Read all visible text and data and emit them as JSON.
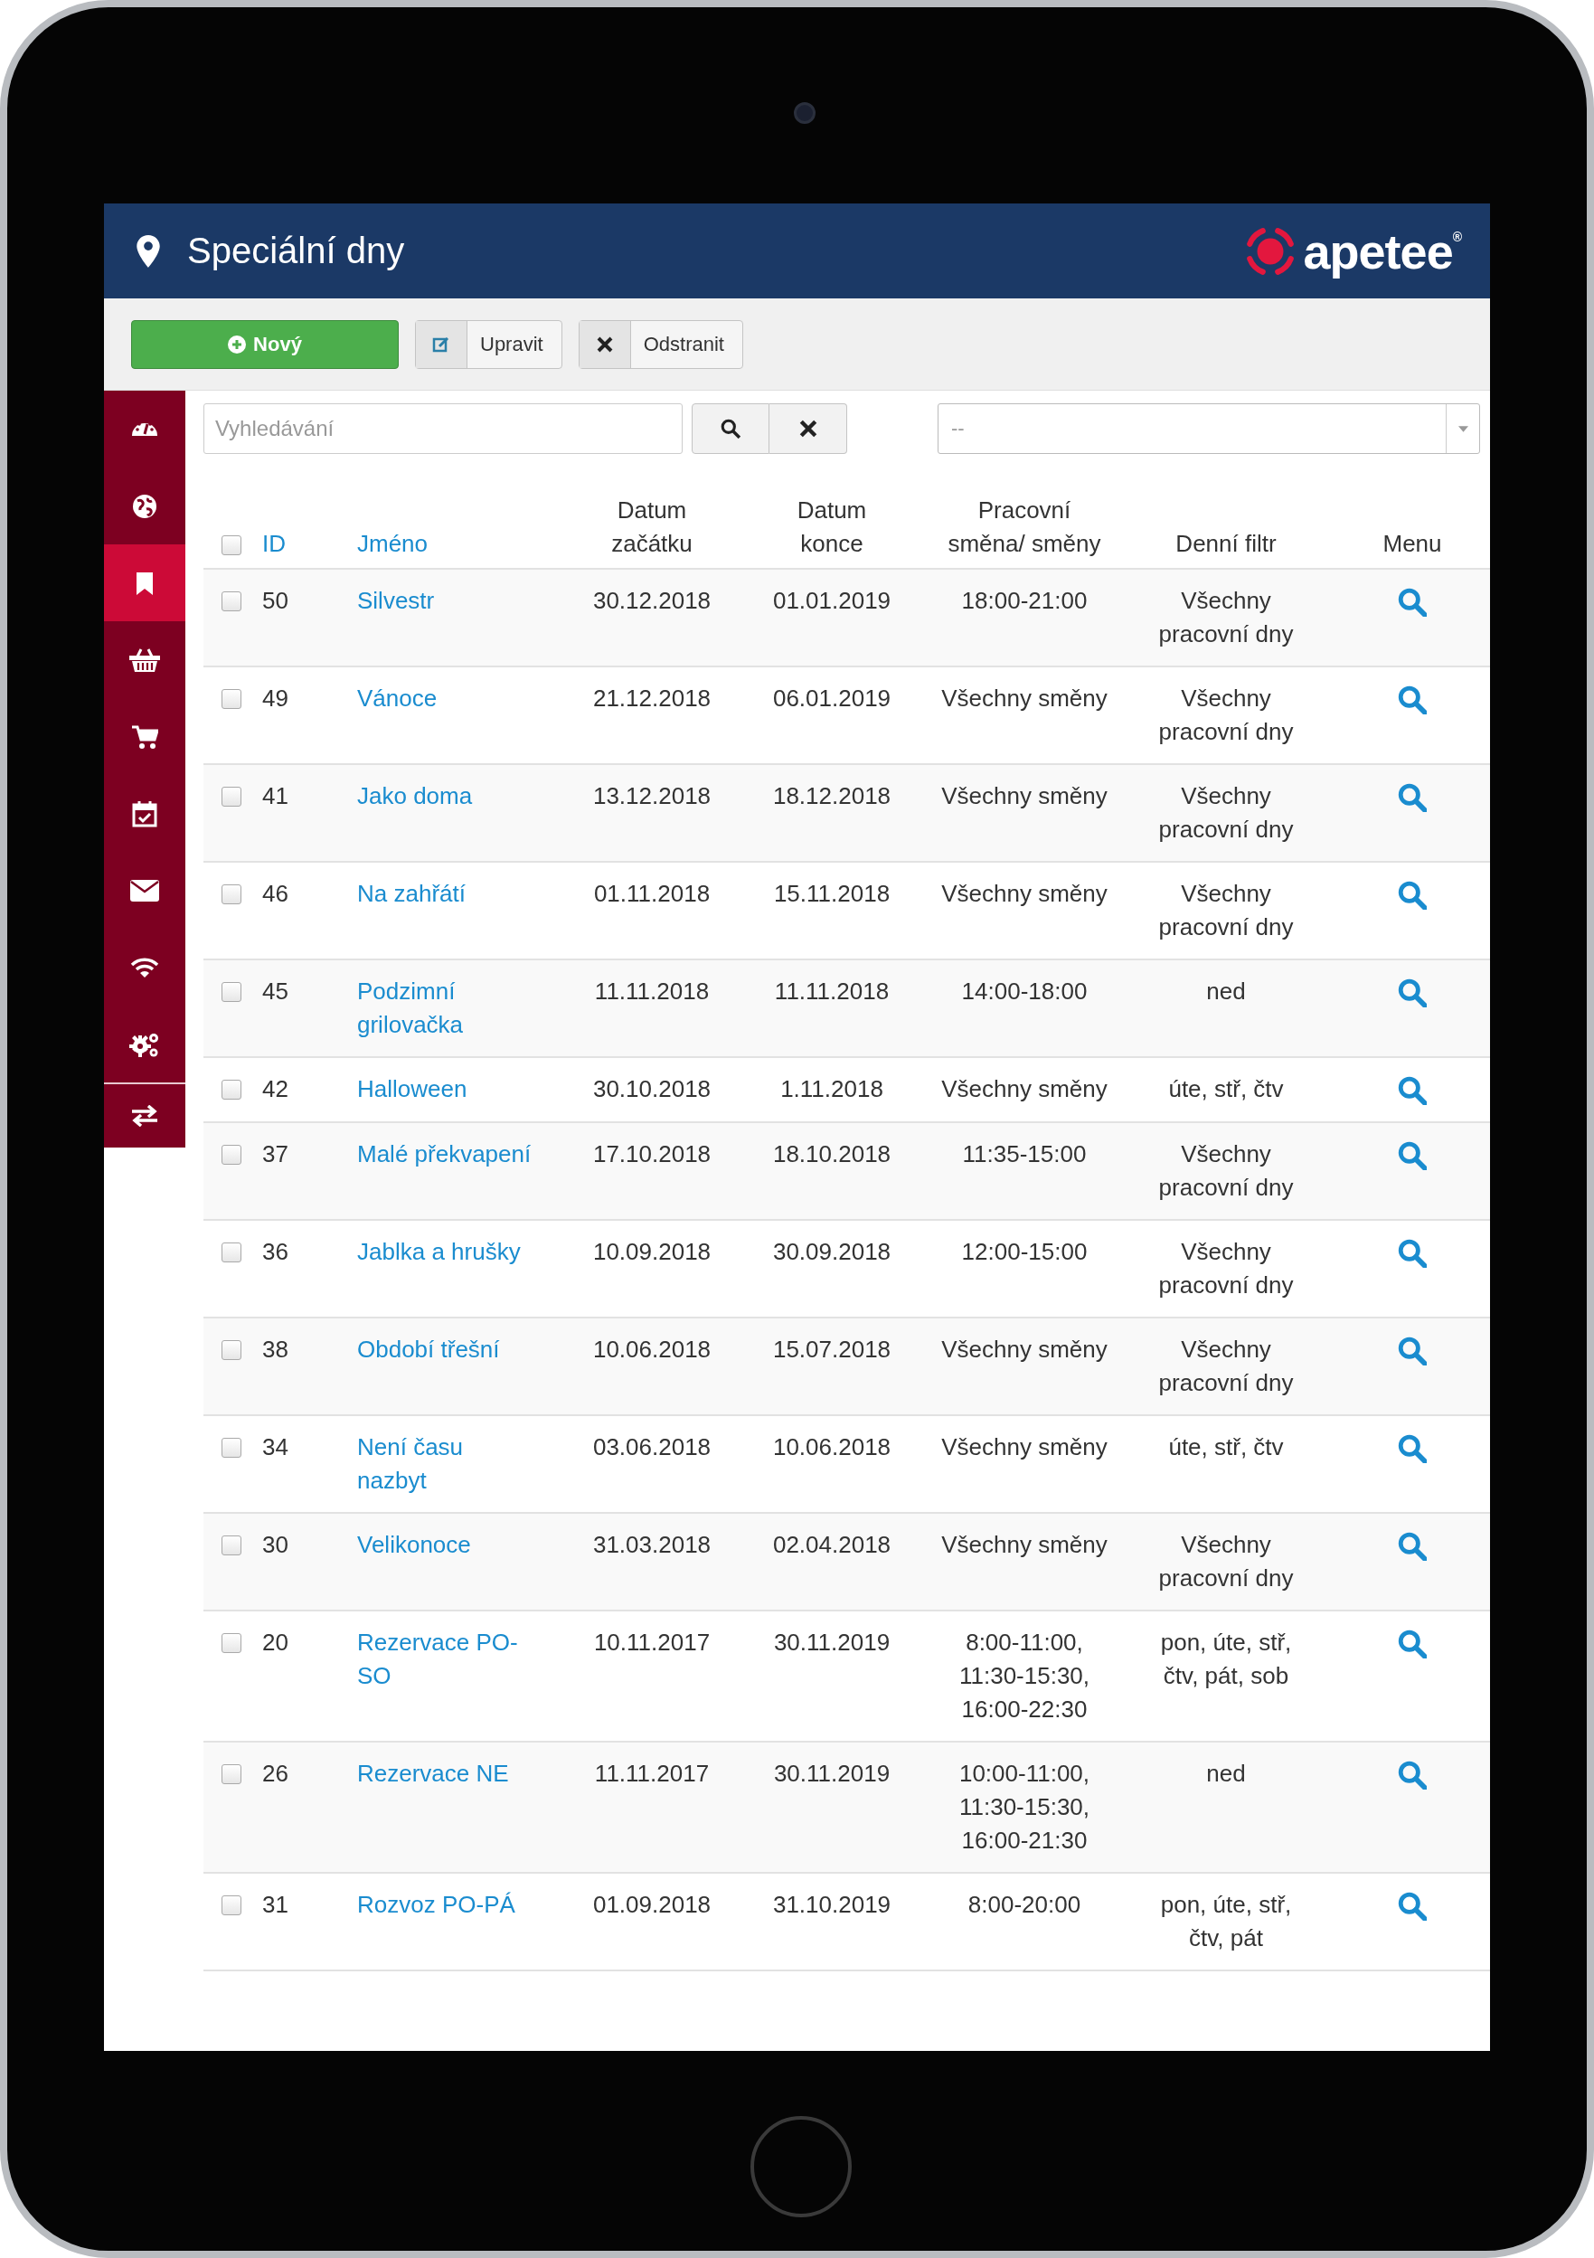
{
  "header": {
    "title": "Speciální dny",
    "logo": "apetee",
    "logo_mark": "®"
  },
  "toolbar": [
    {
      "kind": "new",
      "label": "Nový"
    },
    {
      "kind": "edit",
      "label": "Upravit"
    },
    {
      "kind": "delete",
      "label": "Odstranit"
    }
  ],
  "sidebar": {
    "items": [
      {
        "kind": "gauge",
        "selected": false
      },
      {
        "kind": "globe",
        "selected": false
      },
      {
        "kind": "bookmark",
        "selected": true
      },
      {
        "kind": "basket",
        "selected": false
      },
      {
        "kind": "cart",
        "selected": false
      },
      {
        "kind": "calendar",
        "selected": false
      },
      {
        "kind": "envelope",
        "selected": false
      },
      {
        "kind": "wifi",
        "selected": false
      },
      {
        "kind": "gears",
        "selected": false
      },
      {
        "kind": "swap",
        "selected": false
      }
    ]
  },
  "search": {
    "placeholder": "Vyhledávání"
  },
  "filter_select": {
    "value": "--"
  },
  "table": {
    "select_all_checked": false,
    "columns": [
      {
        "label": "ID",
        "sortable": true
      },
      {
        "label": "Jméno",
        "sortable": true
      },
      {
        "label": "Datum\nzačátku",
        "sortable": false
      },
      {
        "label": "Datum\nkonce",
        "sortable": false
      },
      {
        "label": "Pracovní\nsměna/ směny",
        "sortable": false
      },
      {
        "label": "Denní filtr",
        "sortable": false
      },
      {
        "label": "Menu",
        "sortable": false
      }
    ],
    "rows": [
      {
        "checked": false,
        "id": "50",
        "name": "Silvestr",
        "start": "30.12.2018",
        "end": "01.01.2019",
        "shift": "18:00-21:00",
        "day_filter": "Všechny\npracovní dny"
      },
      {
        "checked": false,
        "id": "49",
        "name": "Vánoce",
        "start": "21.12.2018",
        "end": "06.01.2019",
        "shift": "Všechny směny",
        "day_filter": "Všechny\npracovní dny"
      },
      {
        "checked": false,
        "id": "41",
        "name": "Jako doma",
        "start": "13.12.2018",
        "end": "18.12.2018",
        "shift": "Všechny směny",
        "day_filter": "Všechny\npracovní dny"
      },
      {
        "checked": false,
        "id": "46",
        "name": "Na zahřátí",
        "start": "01.11.2018",
        "end": "15.11.2018",
        "shift": "Všechny směny",
        "day_filter": "Všechny\npracovní dny"
      },
      {
        "checked": false,
        "id": "45",
        "name": "Podzimní\ngrilovačka",
        "start": "11.11.2018",
        "end": "11.11.2018",
        "shift": "14:00-18:00",
        "day_filter": "ned"
      },
      {
        "checked": false,
        "id": "42",
        "name": "Halloween",
        "start": "30.10.2018",
        "end": "1.11.2018",
        "shift": "Všechny směny",
        "day_filter": "úte, stř, čtv"
      },
      {
        "checked": false,
        "id": "37",
        "name": "Malé překvapení",
        "start": "17.10.2018",
        "end": "18.10.2018",
        "shift": "11:35-15:00",
        "day_filter": "Všechny\npracovní dny"
      },
      {
        "checked": false,
        "id": "36",
        "name": "Jablka a hrušky",
        "start": "10.09.2018",
        "end": "30.09.2018",
        "shift": "12:00-15:00",
        "day_filter": "Všechny\npracovní dny"
      },
      {
        "checked": false,
        "id": "38",
        "name": "Období třešní",
        "start": "10.06.2018",
        "end": "15.07.2018",
        "shift": "Všechny směny",
        "day_filter": "Všechny\npracovní dny"
      },
      {
        "checked": false,
        "id": "34",
        "name": "Není času\nnazbyt",
        "start": "03.06.2018",
        "end": "10.06.2018",
        "shift": "Všechny směny",
        "day_filter": "úte, stř, čtv"
      },
      {
        "checked": false,
        "id": "30",
        "name": "Velikonoce",
        "start": "31.03.2018",
        "end": "02.04.2018",
        "shift": "Všechny směny",
        "day_filter": "Všechny\npracovní dny"
      },
      {
        "checked": false,
        "id": "20",
        "name": "Rezervace PO-\nSO",
        "start": "10.11.2017",
        "end": "30.11.2019",
        "shift": "8:00-11:00,\n11:30-15:30,\n16:00-22:30",
        "day_filter": "pon, úte, stř,\nčtv, pát, sob"
      },
      {
        "checked": false,
        "id": "26",
        "name": "Rezervace NE",
        "start": "11.11.2017",
        "end": "30.11.2019",
        "shift": "10:00-11:00,\n11:30-15:30,\n16:00-21:30",
        "day_filter": "ned"
      },
      {
        "checked": false,
        "id": "31",
        "name": "Rozvoz PO-PÁ",
        "start": "01.09.2018",
        "end": "31.10.2019",
        "shift": "8:00-20:00",
        "day_filter": "pon, úte, stř,\nčtv, pát"
      }
    ]
  }
}
